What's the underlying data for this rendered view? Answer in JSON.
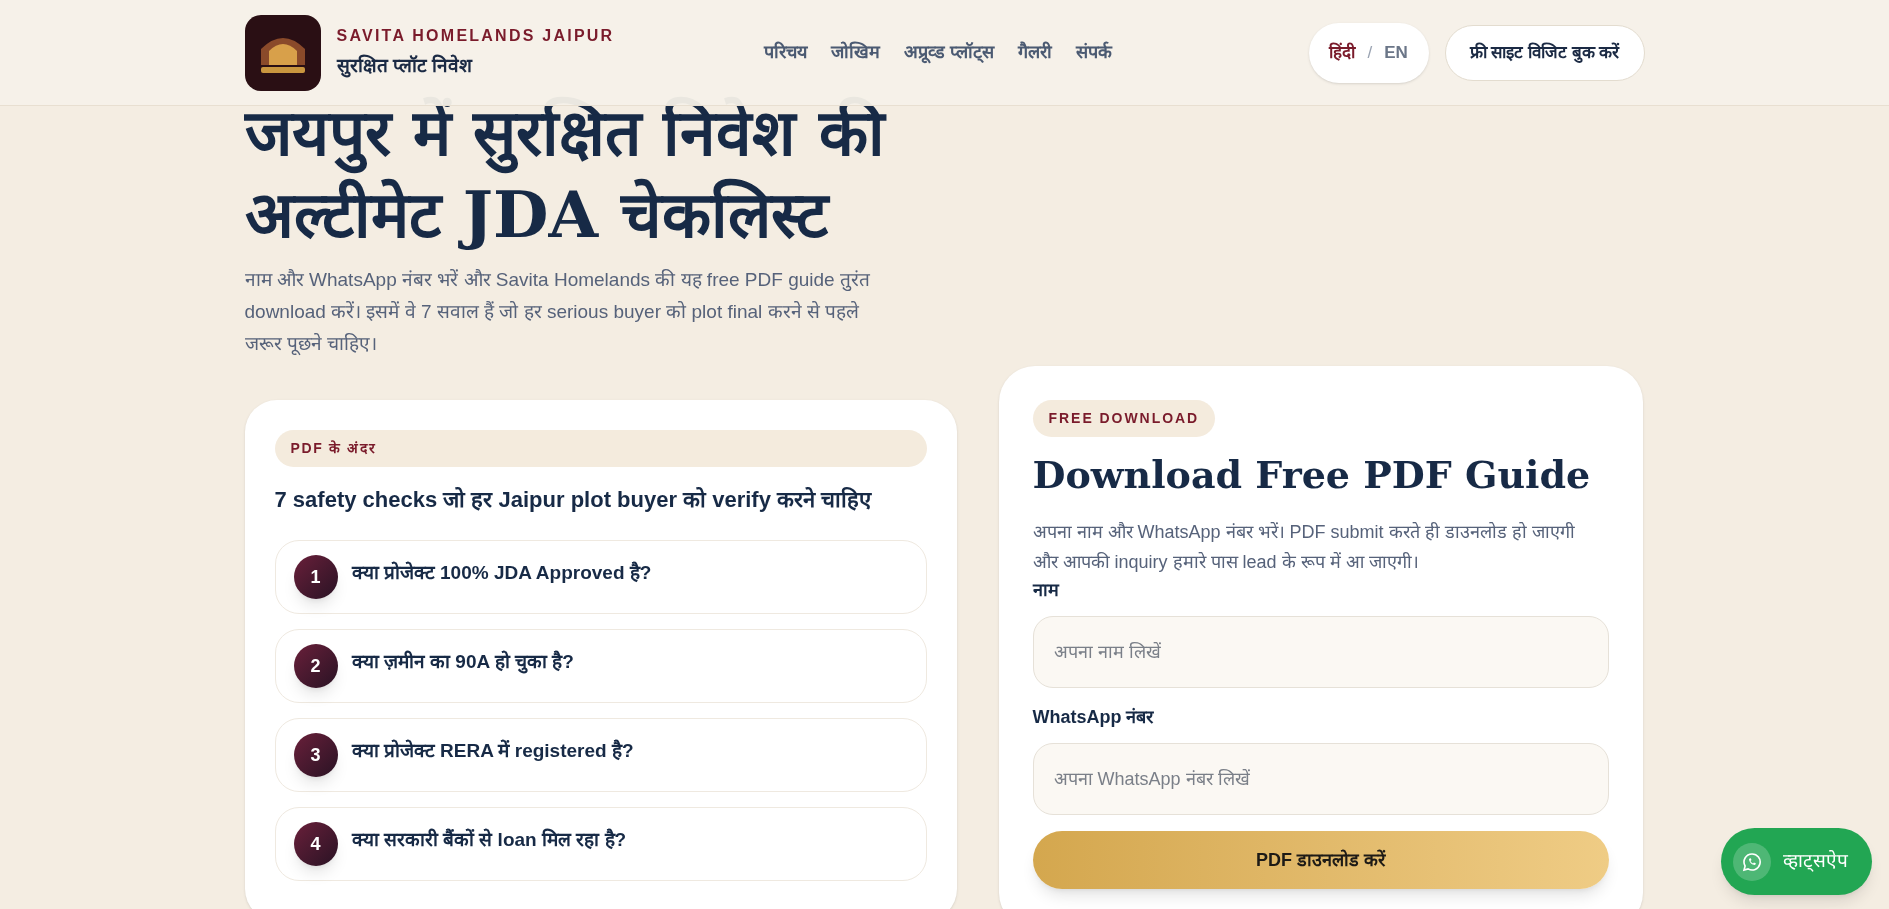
{
  "header": {
    "brand": "SAVITA HOMELANDS JAIPUR",
    "tagline": "सुरक्षित प्लॉट निवेश",
    "nav": [
      {
        "label": "परिचय"
      },
      {
        "label": "जोखिम"
      },
      {
        "label": "अप्रूव्ड प्लॉट्स"
      },
      {
        "label": "गैलरी"
      },
      {
        "label": "संपर्क"
      }
    ],
    "languages": [
      {
        "label": "हिंदी",
        "selected": true
      },
      {
        "label": "EN",
        "selected": false
      }
    ],
    "language_separator": "/",
    "cta": "फ्री साइट विजिट बुक करें"
  },
  "hero": {
    "title_lines": [
      "जयपुर में सुरक्षित निवेश की",
      "अल्टीमेट JDA चेकलिस्ट"
    ],
    "subtitle": "नाम और WhatsApp नंबर भरें और Savita Homelands की यह free PDF guide तुरंत download करें। इसमें वे 7 सवाल हैं जो हर serious buyer को plot final करने से पहले जरूर पूछने चाहिए।"
  },
  "checklist": {
    "badge": "PDF के अंदर",
    "heading": "7 safety checks जो हर Jaipur plot buyer को verify करने चाहिए",
    "items": [
      {
        "number": "1",
        "text": "क्या प्रोजेक्ट 100% JDA Approved है?"
      },
      {
        "number": "2",
        "text": "क्या ज़मीन का 90A हो चुका है?"
      },
      {
        "number": "3",
        "text": "क्या प्रोजेक्ट RERA में registered है?"
      },
      {
        "number": "4",
        "text": "क्या सरकारी बैंकों से loan मिल रहा है?"
      }
    ]
  },
  "form": {
    "badge": "FREE DOWNLOAD",
    "title": "Download Free PDF Guide",
    "description": "अपना नाम और WhatsApp नंबर भरें। PDF submit करते ही डाउनलोड हो जाएगी और आपकी inquiry हमारे पास lead के रूप में आ जाएगी।",
    "fields": [
      {
        "label": "नाम",
        "placeholder": "अपना नाम लिखें"
      },
      {
        "label": "WhatsApp नंबर",
        "placeholder": "अपना WhatsApp नंबर लिखें"
      }
    ],
    "submit": "PDF डाउनलोड करें"
  },
  "whatsapp_button": "व्हाट्सऐप"
}
